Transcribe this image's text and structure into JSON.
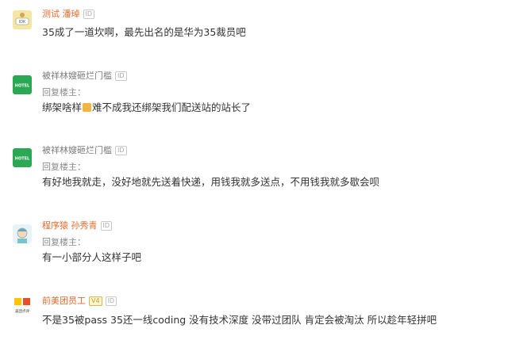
{
  "comments": [
    {
      "username": "测试 潘琸",
      "badge": "ID",
      "text": "35成了一道坎啊，最先出名的是华为35裁员吧",
      "avatar_text": "IDK"
    },
    {
      "username": "被祥林嫂砸烂门槛",
      "badge": "ID",
      "reply_label": "回复楼主：",
      "text_before": "绑架啥样",
      "emoji": "emoji",
      "text_after": "难不成我还绑架我们配送站的站长了",
      "avatar_text": "HOTEL"
    },
    {
      "username": "被祥林嫂砸烂门槛",
      "badge": "ID",
      "reply_label": "回复楼主：",
      "text": "有好地我就走，没好地就先送着快递，用钱我就多送点，不用钱我就多歇会呗",
      "avatar_text": "HOTEL"
    },
    {
      "username": "程序猿 孙秀青",
      "badge": "ID",
      "reply_label": "回复楼主：",
      "text": "有一小部分人这样子吧"
    },
    {
      "username": "前美团员工",
      "vip_badge": "V4",
      "badge": "ID",
      "text": "不是35被pass 35还一线coding 没有技术深度 没带过团队 肯定会被淘汰 所以趁年轻拼吧",
      "avatar_text": "美团点评"
    }
  ],
  "colors": {
    "username_orange": "#e86a2c",
    "username_gray": "#7a7a7a",
    "hotel_green": "#2aa853",
    "vip_gold": "#c69a14"
  }
}
